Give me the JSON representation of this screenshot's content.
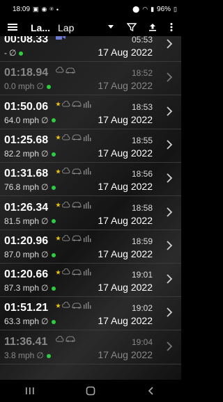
{
  "status_bar": {
    "time": "18:09",
    "battery": "96%"
  },
  "toolbar": {
    "title": "La...",
    "selected_view": "Lap"
  },
  "colors": {
    "dot_green": "#2ecc40",
    "star_yellow": "#f1c40f",
    "divider": "#3a3a3a"
  },
  "laps": [
    {
      "time": "00:08.33",
      "speed": "-",
      "clock": "05:53",
      "date": "17 Aug 2022",
      "faded": false,
      "star": false,
      "cut": true
    },
    {
      "time": "01:18.94",
      "speed": "0.0 mph",
      "clock": "18:52",
      "date": "17 Aug 2022",
      "faded": true,
      "star": false
    },
    {
      "time": "01:50.06",
      "speed": "64.0 mph",
      "clock": "18:53",
      "date": "17 Aug 2022",
      "faded": false,
      "star": true
    },
    {
      "time": "01:25.68",
      "speed": "82.2 mph",
      "clock": "18:55",
      "date": "17 Aug 2022",
      "faded": false,
      "star": true
    },
    {
      "time": "01:31.68",
      "speed": "76.8 mph",
      "clock": "18:56",
      "date": "17 Aug 2022",
      "faded": false,
      "star": true
    },
    {
      "time": "01:26.34",
      "speed": "81.5 mph",
      "clock": "18:58",
      "date": "17 Aug 2022",
      "faded": false,
      "star": true
    },
    {
      "time": "01:20.96",
      "speed": "87.0 mph",
      "clock": "18:59",
      "date": "17 Aug 2022",
      "faded": false,
      "star": true
    },
    {
      "time": "01:20.66",
      "speed": "87.3 mph",
      "clock": "19:01",
      "date": "17 Aug 2022",
      "faded": false,
      "star": true
    },
    {
      "time": "01:51.21",
      "speed": "63.3 mph",
      "clock": "19:02",
      "date": "17 Aug 2022",
      "faded": false,
      "star": true
    },
    {
      "time": "11:36.41",
      "speed": "3.8 mph",
      "clock": "19:04",
      "date": "17 Aug 2022",
      "faded": true,
      "star": false
    }
  ]
}
